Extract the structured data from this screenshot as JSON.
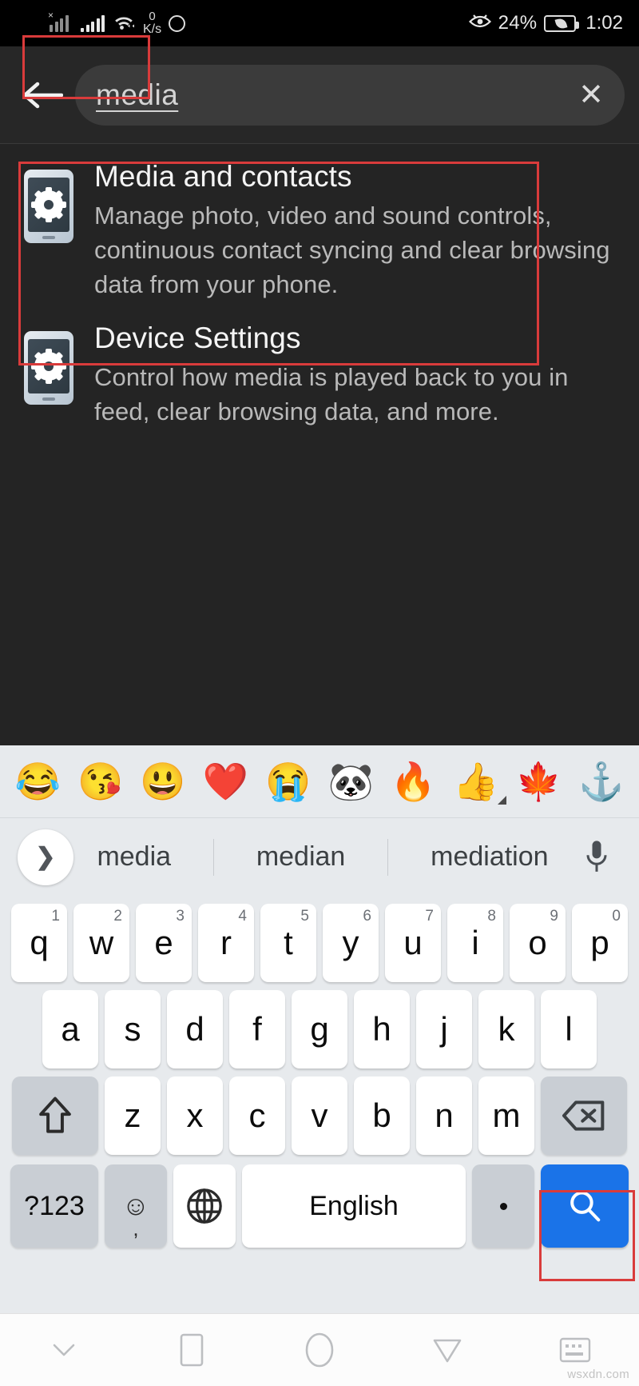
{
  "status_bar": {
    "signal_1_icon": "signal-bars-no-sim-icon",
    "signal_2_icon": "signal-bars-icon",
    "wifi_icon": "wifi-icon",
    "data_rate_value": "0",
    "data_rate_unit": "K/s",
    "circle_icon": "circle-icon",
    "eye_icon": "eye-comfort-icon",
    "battery_percent": "24%",
    "battery_icon": "battery-eco-icon",
    "clock": "1:02"
  },
  "search": {
    "back_icon": "back-arrow-icon",
    "query": "media",
    "clear_icon": "close-x-icon"
  },
  "results": [
    {
      "icon": "phone-settings-icon",
      "title": "Media and contacts",
      "description": "Manage photo, video and sound controls, continuous contact syncing and clear browsing data from your phone."
    },
    {
      "icon": "phone-settings-icon",
      "title": "Device Settings",
      "description": "Control how media is played back to you in feed, clear browsing data, and more."
    }
  ],
  "highlights": {
    "color": "#d93b3b",
    "query_box": "search-query-highlight",
    "result_box": "first-result-highlight",
    "search_key_box": "search-key-highlight"
  },
  "keyboard": {
    "emoji_row": [
      "😂",
      "😘",
      "😃",
      "❤️",
      "😭",
      "🐼",
      "🔥",
      "👍",
      "🍁",
      "⚓"
    ],
    "expand_icon": "chevron-right-icon",
    "suggestions": [
      "media",
      "median",
      "mediation"
    ],
    "mic_icon": "microphone-icon",
    "row1": [
      {
        "key": "q",
        "num": "1"
      },
      {
        "key": "w",
        "num": "2"
      },
      {
        "key": "e",
        "num": "3"
      },
      {
        "key": "r",
        "num": "4"
      },
      {
        "key": "t",
        "num": "5"
      },
      {
        "key": "y",
        "num": "6"
      },
      {
        "key": "u",
        "num": "7"
      },
      {
        "key": "i",
        "num": "8"
      },
      {
        "key": "o",
        "num": "9"
      },
      {
        "key": "p",
        "num": "0"
      }
    ],
    "row2": [
      "a",
      "s",
      "d",
      "f",
      "g",
      "h",
      "j",
      "k",
      "l"
    ],
    "row3_letters": [
      "z",
      "x",
      "c",
      "v",
      "b",
      "n",
      "m"
    ],
    "shift_icon": "shift-arrow-icon",
    "backspace_icon": "backspace-icon",
    "num_symbol_label": "?123",
    "emoji_key_icon": "emoji-smiley-icon",
    "emoji_key_comma": ",",
    "globe_icon": "globe-language-icon",
    "space_label": "English",
    "period_label": ".",
    "search_key_icon": "search-magnifier-icon",
    "accent_color": "#1a73e8"
  },
  "navbar": {
    "items": [
      {
        "icon": "chevron-down-icon",
        "name": "hide-keyboard"
      },
      {
        "icon": "square-icon",
        "name": "recents"
      },
      {
        "icon": "circle-icon",
        "name": "home"
      },
      {
        "icon": "triangle-down-icon",
        "name": "back"
      },
      {
        "icon": "keyboard-icon",
        "name": "keyboard-switch"
      }
    ]
  },
  "watermark": "wsxdn.com"
}
